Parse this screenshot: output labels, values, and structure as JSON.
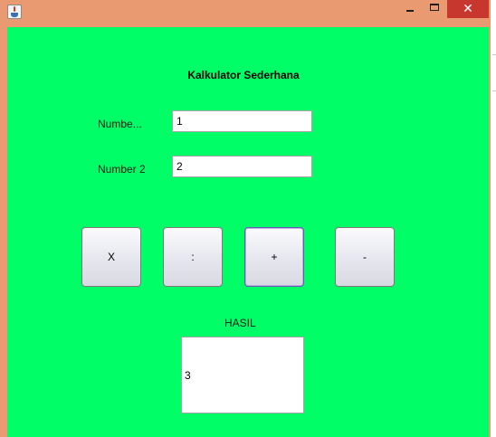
{
  "window": {
    "icon": "java-cup-icon",
    "controls": {
      "minimize": "minimize-icon",
      "maximize": "maximize-icon",
      "close": "✕"
    }
  },
  "form": {
    "title": "Kalkulator Sederhana",
    "number1_label": "Numbe...",
    "number1_value": "1",
    "number2_label": "Number 2",
    "number2_value": "2"
  },
  "buttons": {
    "multiply": "X",
    "divide": ":",
    "add": "+",
    "subtract": "-"
  },
  "result": {
    "label": "HASIL",
    "value": "3"
  },
  "colors": {
    "frame": "#ea9a70",
    "panel": "#00ff66",
    "close_button": "#c7372d"
  }
}
